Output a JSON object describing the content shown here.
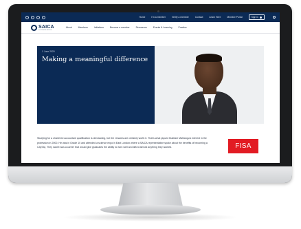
{
  "header": {
    "social_icons": [
      "facebook-icon",
      "twitter-icon",
      "linkedin-icon",
      "instagram-icon"
    ],
    "links": [
      "Home",
      "I'm a member",
      "Verify a member",
      "Contact",
      "Learn Here",
      "Member Portal"
    ],
    "signin_label": "Sign in"
  },
  "brand": {
    "name": "SAICA",
    "tagline": "SOUTHERN AFRICA"
  },
  "nav": {
    "items": [
      "About",
      "Members",
      "Initiatives",
      "Become a member",
      "Resources",
      "Events & Learning",
      "Practice"
    ]
  },
  "hero": {
    "date": "1 June 2020",
    "title": "Making a meaningful difference"
  },
  "article": {
    "body": "Studying for a chartered accountant qualification is demanding, but the rewards are certainly worth it. That's what piqued Bulelani Mahlangu's interest in the profession in 2000. He was in Grade 10 and attended a science expo in East London where a SAICA representative spoke about the benefits of becoming a CA(SA). They said it was a career that would give graduates the ability to earn well and afford almost anything they wanted."
  },
  "badge": {
    "label": "FISA"
  },
  "colors": {
    "navy": "#0b2a55",
    "badge_red": "#e21b23"
  }
}
